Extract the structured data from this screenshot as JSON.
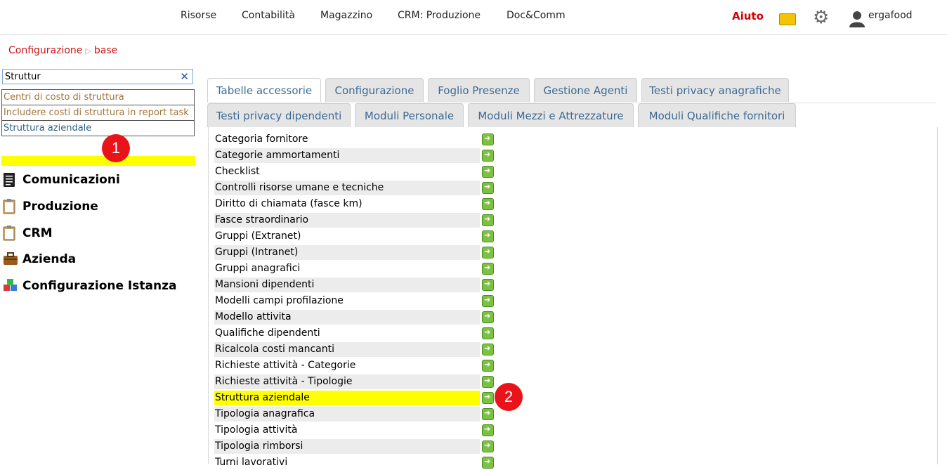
{
  "topnav": {
    "items": [
      "Risorse",
      "Contabilità",
      "Magazzino",
      "CRM: Produzione",
      "Doc&Comm"
    ],
    "help": "Aiuto",
    "user": "ergafood"
  },
  "breadcrumb": {
    "root": "Configurazione",
    "current": "base"
  },
  "search": {
    "value": "Struttur",
    "suggestions": [
      "Centri di costo di struttura",
      "Includere costi di struttura in report task",
      "Struttura aziendale"
    ]
  },
  "menu": {
    "partial": "Risorse",
    "items": [
      "Comunicazioni",
      "Produzione",
      "CRM",
      "Azienda",
      "Configurazione Istanza"
    ]
  },
  "tabs": {
    "row1": [
      "Tabelle accessorie",
      "Configurazione",
      "Foglio Presenze",
      "Gestione Agenti",
      "Testi privacy anagrafiche"
    ],
    "row2": [
      "Testi privacy dipendenti",
      "Moduli Personale",
      "Moduli Mezzi e Attrezzature",
      "Moduli Qualifiche fornitori"
    ]
  },
  "table": {
    "rows": [
      "Categoria fornitore",
      "Categorie ammortamenti",
      "Checklist",
      "Controlli risorse umane e tecniche",
      "Diritto di chiamata (fasce km)",
      "Fasce straordinario",
      "Gruppi (Extranet)",
      "Gruppi (Intranet)",
      "Gruppi anagrafici",
      "Mansioni dipendenti",
      "Modelli campi profilazione",
      "Modello attivita",
      "Qualifiche dipendenti",
      "Ricalcola costi mancanti",
      "Richieste attività - Categorie",
      "Richieste attività - Tipologie",
      "Struttura aziendale",
      "Tipologia anagrafica",
      "Tipologia attività",
      "Tipologia rimborsi",
      "Turni lavorativi"
    ],
    "selected_row": "Struttura aziendale"
  },
  "badges": {
    "first": "1",
    "second": "2"
  },
  "colors": {
    "highlight": "#ffff00",
    "accent": "#d40000",
    "tab_text": "#3d6a95",
    "badge": "#e8141a",
    "go": "#7cc242"
  }
}
